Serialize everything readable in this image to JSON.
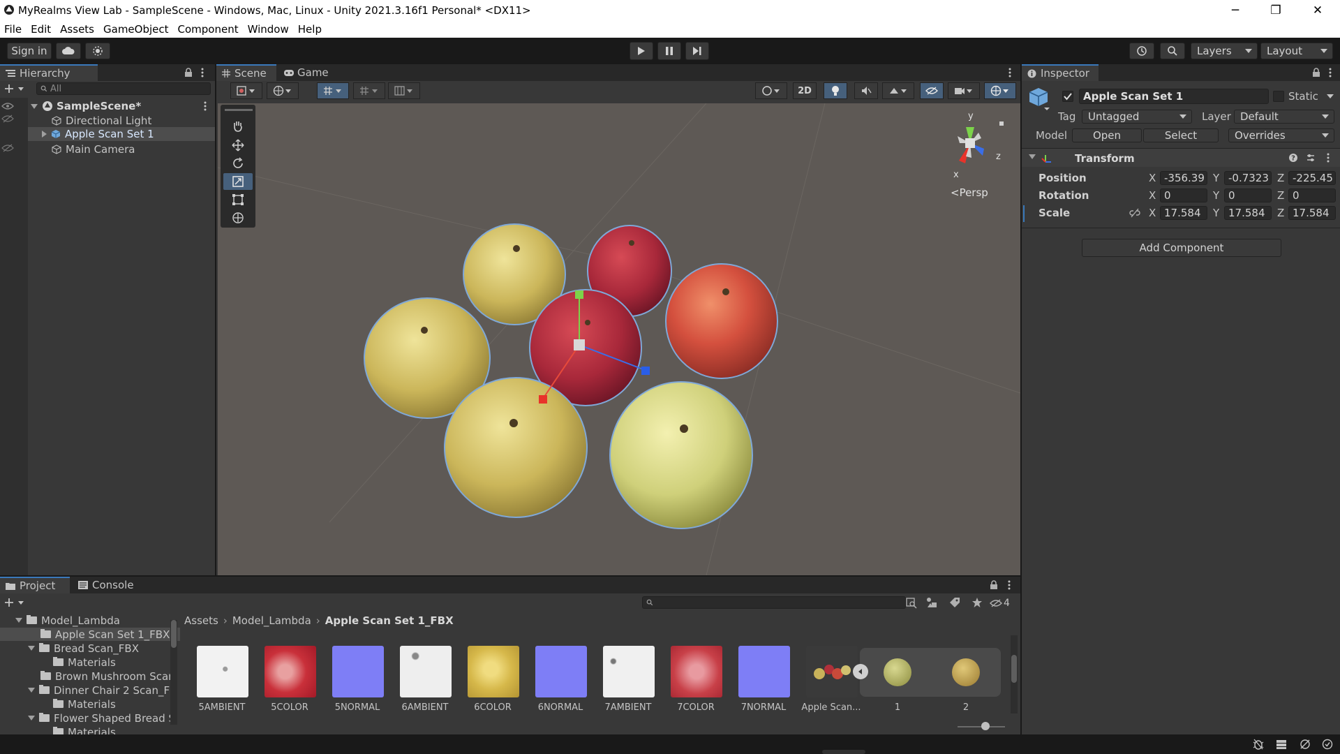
{
  "window": {
    "title": "MyRealms View Lab - SampleScene - Windows, Mac, Linux - Unity 2021.3.16f1 Personal* <DX11>",
    "minimize": "─",
    "maximize": "❐",
    "close": "✕"
  },
  "menu": [
    "File",
    "Edit",
    "Assets",
    "GameObject",
    "Component",
    "Window",
    "Help"
  ],
  "toolbar": {
    "sign_in": "Sign in",
    "layers": "Layers",
    "layout": "Layout"
  },
  "hierarchy": {
    "tab": "Hierarchy",
    "search_placeholder": "All",
    "scene": "SampleScene*",
    "items": [
      "Directional Light",
      "Apple Scan Set 1",
      "Main Camera"
    ]
  },
  "scene_view": {
    "tabs": [
      "Scene",
      "Game"
    ],
    "mode_2d": "2D",
    "persp_label": "<Persp",
    "axis_y": "y",
    "axis_z": "z",
    "axis_x": "x"
  },
  "inspector": {
    "tab": "Inspector",
    "object_name": "Apple Scan Set 1",
    "static_label": "Static",
    "tag_label": "Tag",
    "tag_value": "Untagged",
    "layer_label": "Layer",
    "layer_value": "Default",
    "model_label": "Model",
    "open_button": "Open",
    "select_button": "Select",
    "overrides_label": "Overrides",
    "component": "Transform",
    "position_label": "Position",
    "rotation_label": "Rotation",
    "scale_label": "Scale",
    "axis_x": "X",
    "axis_y": "Y",
    "axis_z": "Z",
    "position": {
      "x": "-356.39",
      "y": "-0.7323",
      "z": "-225.45"
    },
    "rotation": {
      "x": "0",
      "y": "0",
      "z": "0"
    },
    "scale": {
      "x": "17.584",
      "y": "17.584",
      "z": "17.584"
    },
    "add_component": "Add Component"
  },
  "project": {
    "tabs": [
      "Project",
      "Console"
    ],
    "hidden_count": "4",
    "breadcrumb": [
      "Assets",
      "Model_Lambda",
      "Apple Scan Set 1_FBX"
    ],
    "tree": [
      "Model_Lambda",
      "Apple Scan Set 1_FBX",
      "Bread Scan_FBX",
      "Materials",
      "Brown Mushroom Scar",
      "Dinner Chair 2 Scan_FE",
      "Materials",
      "Flower Shaped Bread S",
      "Materials"
    ],
    "assets": [
      "5AMBIENT",
      "5COLOR",
      "5NORMAL",
      "6AMBIENT",
      "6COLOR",
      "6NORMAL",
      "7AMBIENT",
      "7COLOR",
      "7NORMAL",
      "Apple Scan...",
      "1",
      "2"
    ]
  },
  "colors": {
    "accent_blue": "#3a79bb",
    "selection": "#4d4d4d",
    "scene_bg": "#5e5955"
  }
}
